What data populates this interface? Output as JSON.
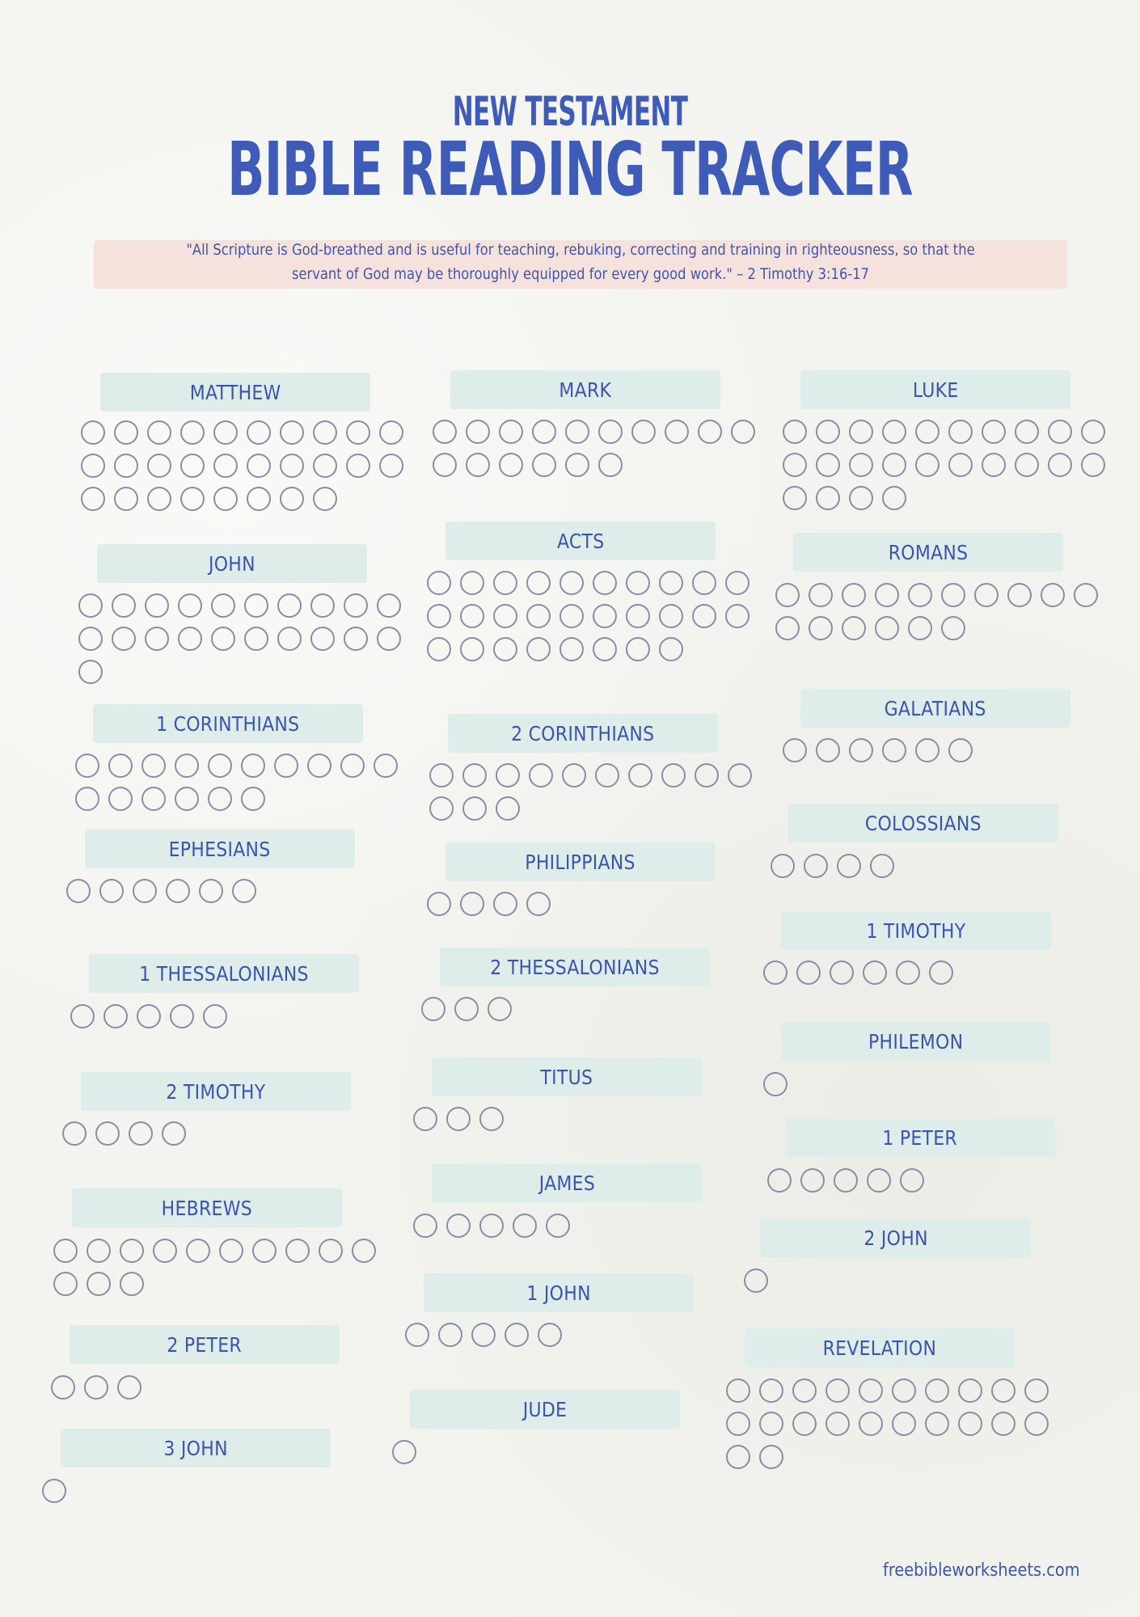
{
  "header": {
    "subtitle": "NEW TESTAMENT",
    "title": "BIBLE READING TRACKER",
    "quote": "\"All Scripture is God-breathed and is useful for teaching, rebuking, correcting and training in righteousness, so that the servant of God may be thoroughly equipped for every good work.\" – 2 Timothy 3:16-17"
  },
  "colors": {
    "title": "#3e5cb7",
    "label_background": "#deede9",
    "quote_background": "#f6e2dc",
    "circle_stroke": "#898ea6",
    "page_background": "#f3f3ef"
  },
  "books": [
    {
      "name": "MATTHEW",
      "chapters": 28,
      "read": 0
    },
    {
      "name": "MARK",
      "chapters": 16,
      "read": 0
    },
    {
      "name": "LUKE",
      "chapters": 24,
      "read": 0
    },
    {
      "name": "JOHN",
      "chapters": 21,
      "read": 0
    },
    {
      "name": "ACTS",
      "chapters": 28,
      "read": 0
    },
    {
      "name": "ROMANS",
      "chapters": 16,
      "read": 0
    },
    {
      "name": "1 CORINTHIANS",
      "chapters": 16,
      "read": 0
    },
    {
      "name": "2 CORINTHIANS",
      "chapters": 13,
      "read": 0
    },
    {
      "name": "GALATIANS",
      "chapters": 6,
      "read": 0
    },
    {
      "name": "EPHESIANS",
      "chapters": 6,
      "read": 0
    },
    {
      "name": "PHILIPPIANS",
      "chapters": 4,
      "read": 0
    },
    {
      "name": "COLOSSIANS",
      "chapters": 4,
      "read": 0
    },
    {
      "name": "1 THESSALONIANS",
      "chapters": 5,
      "read": 0
    },
    {
      "name": "2 THESSALONIANS",
      "chapters": 3,
      "read": 0
    },
    {
      "name": "1 TIMOTHY",
      "chapters": 6,
      "read": 0
    },
    {
      "name": "2 TIMOTHY",
      "chapters": 4,
      "read": 0
    },
    {
      "name": "TITUS",
      "chapters": 3,
      "read": 0
    },
    {
      "name": "PHILEMON",
      "chapters": 1,
      "read": 0
    },
    {
      "name": "HEBREWS",
      "chapters": 13,
      "read": 0
    },
    {
      "name": "JAMES",
      "chapters": 5,
      "read": 0
    },
    {
      "name": "1 PETER",
      "chapters": 5,
      "read": 0
    },
    {
      "name": "2 PETER",
      "chapters": 3,
      "read": 0
    },
    {
      "name": "1 JOHN",
      "chapters": 5,
      "read": 0
    },
    {
      "name": "2 JOHN",
      "chapters": 1,
      "read": 0
    },
    {
      "name": "3 JOHN",
      "chapters": 1,
      "read": 0
    },
    {
      "name": "JUDE",
      "chapters": 1,
      "read": 0
    },
    {
      "name": "REVELATION",
      "chapters": 22,
      "read": 0
    }
  ],
  "footer": {
    "website": "freebibleworksheets.com"
  }
}
